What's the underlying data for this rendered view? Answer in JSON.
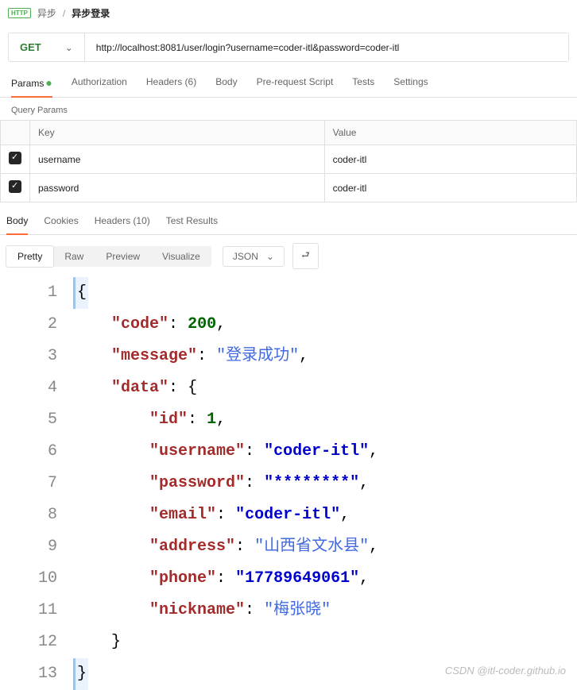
{
  "breadcrumb": {
    "badge": "HTTP",
    "parent": "异步",
    "current": "异步登录"
  },
  "request": {
    "method": "GET",
    "url": "http://localhost:8081/user/login?username=coder-itl&password=coder-itl"
  },
  "tabs": {
    "params": "Params",
    "auth": "Authorization",
    "headers": "Headers (6)",
    "body": "Body",
    "prereq": "Pre-request Script",
    "tests": "Tests",
    "settings": "Settings"
  },
  "qp": {
    "title": "Query Params",
    "key_h": "Key",
    "val_h": "Value",
    "rows": [
      {
        "k": "username",
        "v": "coder-itl"
      },
      {
        "k": "password",
        "v": "coder-itl"
      }
    ]
  },
  "resp_tabs": {
    "body": "Body",
    "cookies": "Cookies",
    "headers": "Headers (10)",
    "tests": "Test Results"
  },
  "viewseg": {
    "pretty": "Pretty",
    "raw": "Raw",
    "preview": "Preview",
    "visualize": "Visualize"
  },
  "format": "JSON",
  "json_body": {
    "code": 200,
    "message": "登录成功",
    "data": {
      "id": 1,
      "username": "coder-itl",
      "password": "********",
      "email": "coder-itl",
      "address": "山西省文水县",
      "phone": "17789649061",
      "nickname": "梅张晓"
    }
  },
  "watermark": "CSDN @itl-coder.github.io"
}
